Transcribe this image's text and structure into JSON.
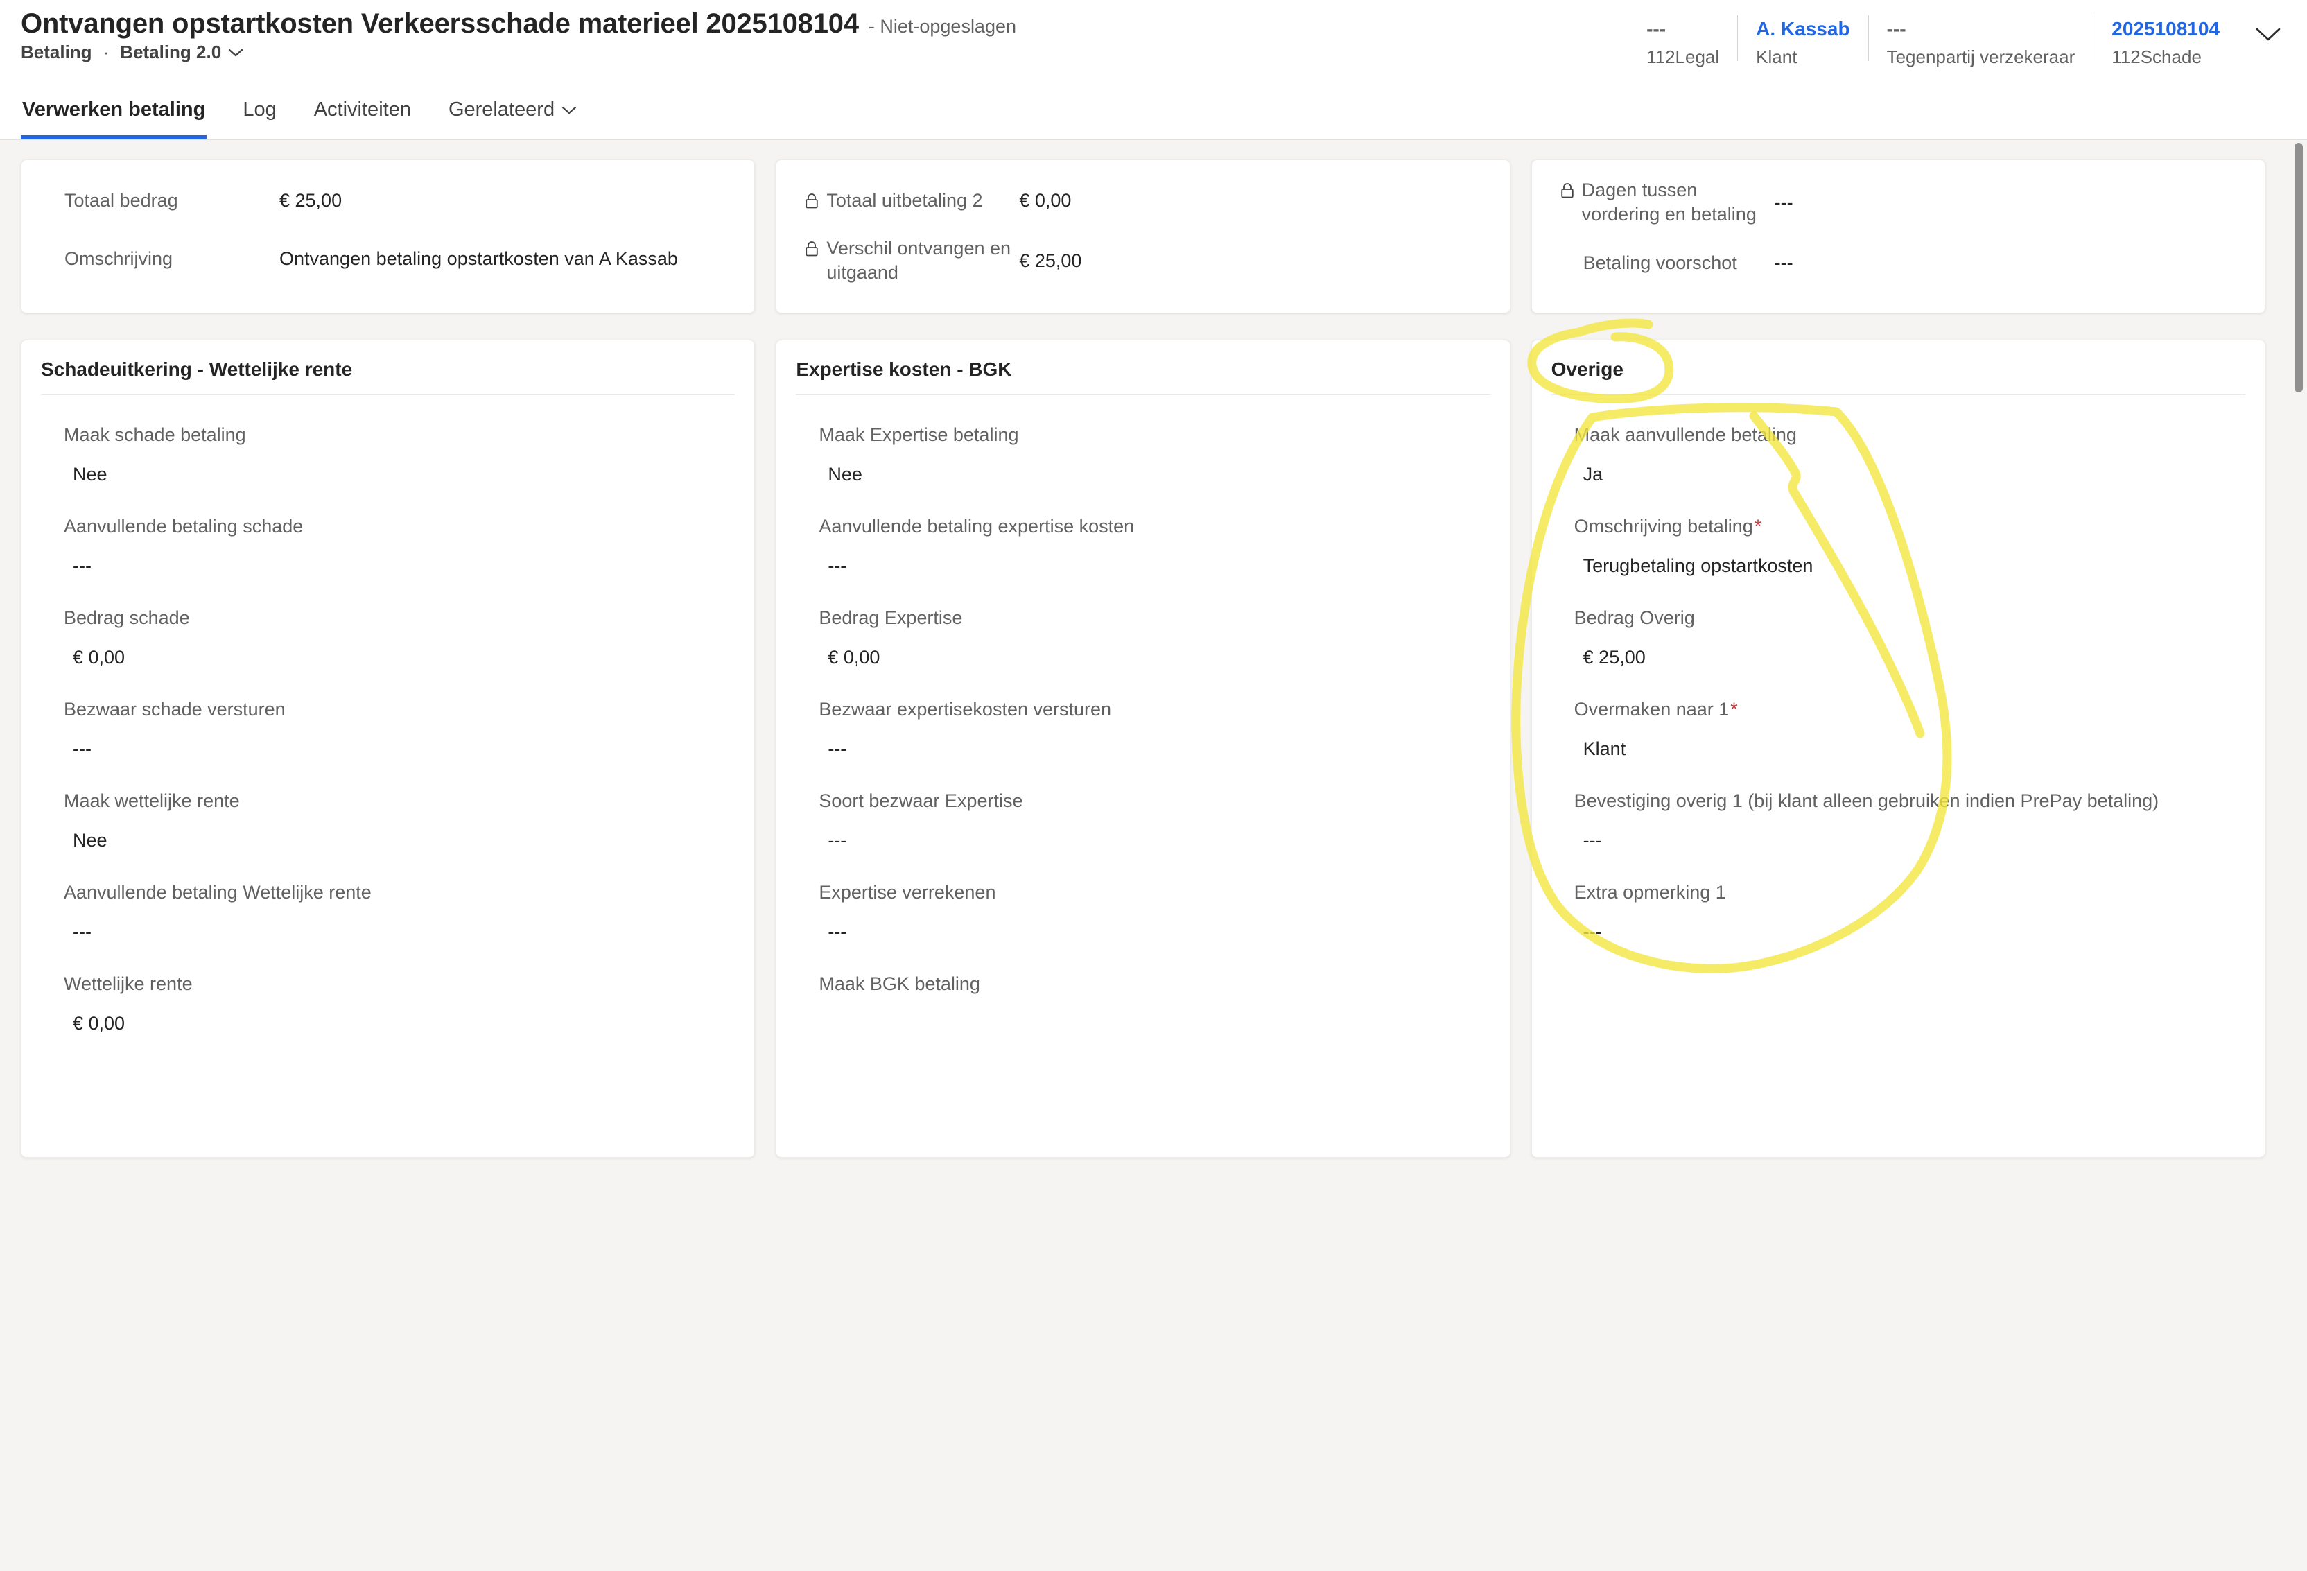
{
  "colors": {
    "accent": "#2266E3",
    "required": "#D13438",
    "annotation": "#F2E53C"
  },
  "marks": {
    "required": "*"
  },
  "header": {
    "title": "Ontvangen opstartkosten Verkeersschade materieel 2025108104",
    "save_status": "- Niet-opgeslagen",
    "record_type": "Betaling",
    "separator": "·",
    "form_selector": "Betaling 2.0",
    "summary": [
      {
        "value": "---",
        "label": "112Legal"
      },
      {
        "value": "A. Kassab",
        "label": "Klant"
      },
      {
        "value": "---",
        "label": "Tegenpartij verzekeraar"
      },
      {
        "value": "2025108104",
        "label": "112Schade"
      }
    ]
  },
  "tabs": [
    {
      "label": "Verwerken betaling",
      "active": true
    },
    {
      "label": "Log",
      "active": false
    },
    {
      "label": "Activiteiten",
      "active": false
    },
    {
      "label": "Gerelateerd",
      "active": false
    }
  ],
  "cards": {
    "totals": {
      "fields": [
        {
          "label": "Totaal bedrag",
          "value": "€ 25,00"
        },
        {
          "label": "Omschrijving",
          "value": "Ontvangen betaling opstartkosten van A Kassab"
        }
      ]
    },
    "uitbetaling": {
      "fields": [
        {
          "label": "Totaal uitbetaling 2",
          "value": "€ 0,00",
          "locked": true
        },
        {
          "label": "Verschil ontvangen en uitgaand",
          "value": "€ 25,00",
          "locked": true
        }
      ]
    },
    "dagen": {
      "fields": [
        {
          "label": "Dagen tussen vordering en betaling",
          "value": "---",
          "locked": true
        },
        {
          "label": "Betaling voorschot",
          "value": "---"
        }
      ]
    },
    "schade": {
      "title": "Schadeuitkering - Wettelijke rente",
      "fields": [
        {
          "label": "Maak schade betaling",
          "value": "Nee"
        },
        {
          "label": "Aanvullende betaling schade",
          "value": "---"
        },
        {
          "label": "Bedrag schade",
          "value": "€ 0,00"
        },
        {
          "label": "Bezwaar schade versturen",
          "value": "---"
        },
        {
          "label": "Maak wettelijke rente",
          "value": "Nee"
        },
        {
          "label": "Aanvullende betaling Wettelijke rente",
          "value": "---"
        },
        {
          "label": "Wettelijke rente",
          "value": "€ 0,00"
        }
      ]
    },
    "expertise": {
      "title": "Expertise kosten - BGK",
      "fields": [
        {
          "label": "Maak Expertise betaling",
          "value": "Nee"
        },
        {
          "label": "Aanvullende betaling expertise kosten",
          "value": "---"
        },
        {
          "label": "Bedrag Expertise",
          "value": "€ 0,00"
        },
        {
          "label": "Bezwaar expertisekosten versturen",
          "value": "---"
        },
        {
          "label": "Soort bezwaar Expertise",
          "value": "---"
        },
        {
          "label": "Expertise verrekenen",
          "value": "---"
        },
        {
          "label": "Maak BGK betaling",
          "value": ""
        }
      ]
    },
    "overige": {
      "title": "Overige",
      "fields": [
        {
          "label": "Maak aanvullende betaling",
          "value": "Ja"
        },
        {
          "label": "Omschrijving betaling",
          "required": true,
          "value": "Terugbetaling opstartkosten"
        },
        {
          "label": "Bedrag Overig",
          "value": "€ 25,00"
        },
        {
          "label": "Overmaken naar 1",
          "required": true,
          "value": "Klant"
        },
        {
          "label": "Bevestiging overig 1 (bij klant alleen gebruiken indien PrePay betaling)",
          "value": "---"
        },
        {
          "label": "Extra opmerking 1",
          "value": "---"
        }
      ]
    }
  }
}
